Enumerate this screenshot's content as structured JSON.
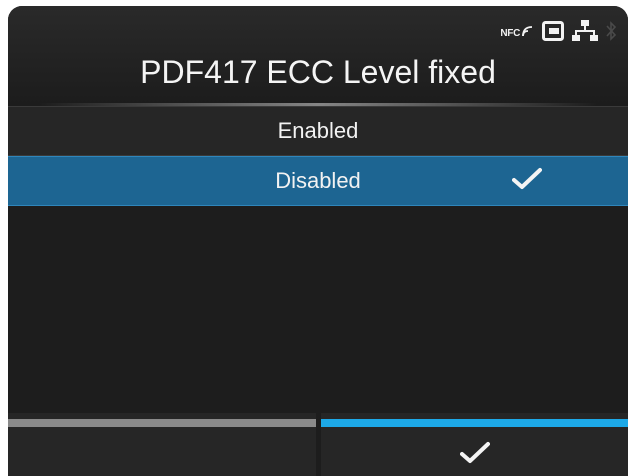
{
  "status_bar": {
    "nfc_label": "NFC",
    "icons": [
      "nfc-icon",
      "usb-icon",
      "network-icon",
      "bluetooth-icon"
    ]
  },
  "header": {
    "title": "PDF417 ECC Level fixed"
  },
  "options": [
    {
      "label": "Enabled",
      "selected": false
    },
    {
      "label": "Disabled",
      "selected": true
    }
  ],
  "softkeys": {
    "left": {
      "bar_color": "#8a8a8a"
    },
    "right": {
      "bar_color": "#1da9e8",
      "icon": "check-icon"
    }
  },
  "colors": {
    "selection": "#1d6592",
    "accent": "#1da9e8",
    "background": "#1d1d1d"
  }
}
